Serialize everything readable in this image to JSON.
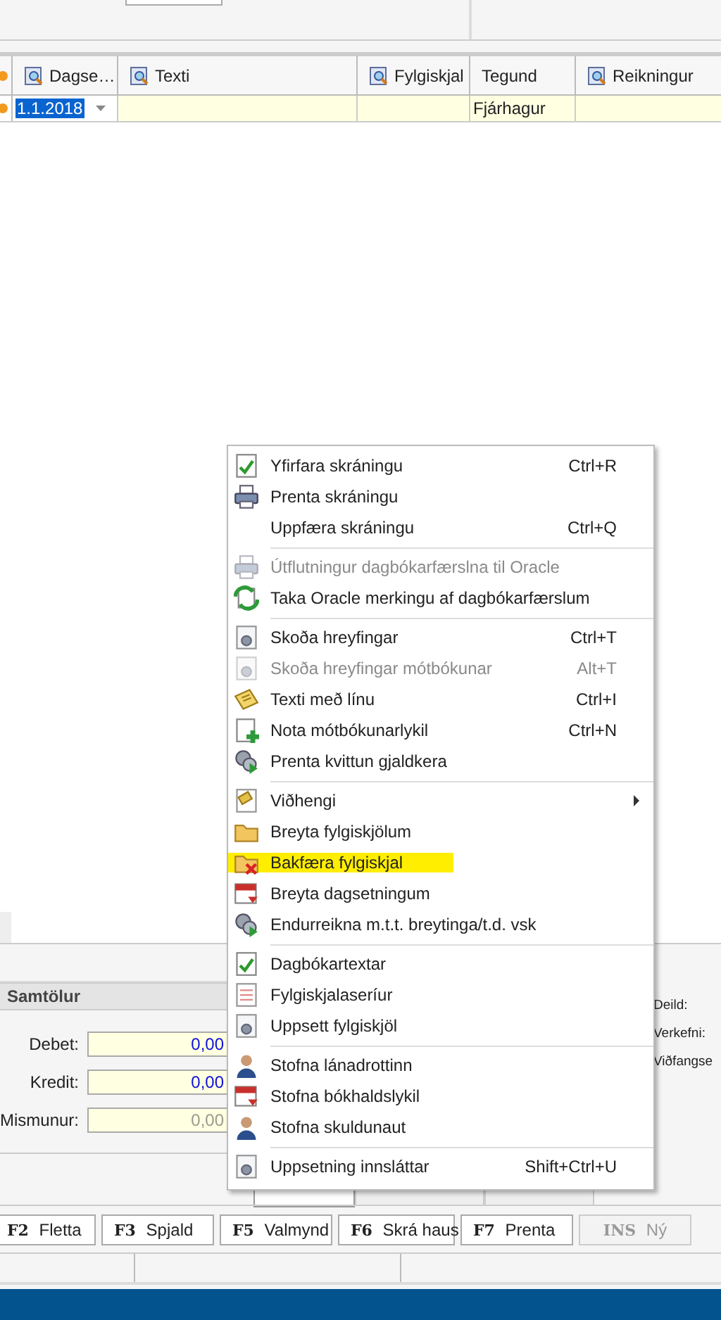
{
  "grid": {
    "columns": [
      {
        "label": "Dagse…"
      },
      {
        "label": "Texti"
      },
      {
        "label": "Fylgiskjal"
      },
      {
        "label": "Tegund"
      },
      {
        "label": "Reikningur"
      }
    ],
    "row": {
      "date": "1.1.2018",
      "cells": [
        "",
        "",
        "Fjárhagur",
        ""
      ]
    }
  },
  "summary": {
    "title": "Samtölur",
    "fields": [
      {
        "label": "Debet:",
        "value": "0,00",
        "disabled": false
      },
      {
        "label": "Kredit:",
        "value": "0,00",
        "disabled": false
      },
      {
        "label": "Mismunur:",
        "value": "0,00",
        "disabled": true
      }
    ]
  },
  "side_labels": [
    "Deild:",
    "Verkefni:",
    "Viðfangse"
  ],
  "tabs": [
    {
      "selected": true
    },
    {
      "selected": false
    },
    {
      "selected": false
    }
  ],
  "function_keys": [
    {
      "key": "F2",
      "label": "Fletta",
      "disabled": false
    },
    {
      "key": "F3",
      "label": "Spjald",
      "disabled": false
    },
    {
      "key": "F5",
      "label": "Valmynd",
      "disabled": false
    },
    {
      "key": "F6",
      "label": "Skrá haus",
      "disabled": false
    },
    {
      "key": "F7",
      "label": "Prenta",
      "disabled": false
    },
    {
      "key": "INS",
      "label": "Ný",
      "disabled": true
    }
  ],
  "context_menu": [
    {
      "kind": "item",
      "label": "Yfirfara skráningu",
      "shortcut": "Ctrl+R",
      "disabled": false,
      "highlighted": false,
      "submenu": false
    },
    {
      "kind": "item",
      "label": "Prenta skráningu",
      "disabled": false,
      "highlighted": false,
      "submenu": false
    },
    {
      "kind": "item",
      "label": "Uppfæra skráningu",
      "shortcut": "Ctrl+Q",
      "disabled": false,
      "highlighted": false,
      "submenu": false
    },
    {
      "kind": "separator"
    },
    {
      "kind": "item",
      "label": "Útflutningur dagbókarfærslna til Oracle",
      "disabled": true,
      "highlighted": false,
      "submenu": false
    },
    {
      "kind": "item",
      "label": "Taka Oracle merkingu af dagbókarfærslum",
      "disabled": false,
      "highlighted": false,
      "submenu": false
    },
    {
      "kind": "separator"
    },
    {
      "kind": "item",
      "label": "Skoða hreyfingar",
      "shortcut": "Ctrl+T",
      "disabled": false,
      "highlighted": false,
      "submenu": false
    },
    {
      "kind": "item",
      "label": "Skoða hreyfingar mótbókunar",
      "shortcut": "Alt+T",
      "disabled": true,
      "highlighted": false,
      "submenu": false
    },
    {
      "kind": "item",
      "label": "Texti með línu",
      "shortcut": "Ctrl+I",
      "disabled": false,
      "highlighted": false,
      "submenu": false
    },
    {
      "kind": "item",
      "label": "Nota mótbókunarlykil",
      "shortcut": "Ctrl+N",
      "disabled": false,
      "highlighted": false,
      "submenu": false
    },
    {
      "kind": "item",
      "label": "Prenta kvittun gjaldkera",
      "disabled": false,
      "highlighted": false,
      "submenu": false
    },
    {
      "kind": "separator"
    },
    {
      "kind": "item",
      "label": "Viðhengi",
      "disabled": false,
      "highlighted": false,
      "submenu": true
    },
    {
      "kind": "item",
      "label": "Breyta fylgiskjölum",
      "disabled": false,
      "highlighted": false,
      "submenu": false
    },
    {
      "kind": "item",
      "label": "Bakfæra fylgiskjal",
      "disabled": false,
      "highlighted": true,
      "submenu": false
    },
    {
      "kind": "item",
      "label": "Breyta dagsetningum",
      "disabled": false,
      "highlighted": false,
      "submenu": false
    },
    {
      "kind": "item",
      "label": "Endurreikna m.t.t. breytinga/t.d. vsk",
      "disabled": false,
      "highlighted": false,
      "submenu": false
    },
    {
      "kind": "separator"
    },
    {
      "kind": "item",
      "label": "Dagbókartextar",
      "disabled": false,
      "highlighted": false,
      "submenu": false
    },
    {
      "kind": "item",
      "label": "Fylgiskjalaseríur",
      "disabled": false,
      "highlighted": false,
      "submenu": false
    },
    {
      "kind": "item",
      "label": "Uppsett fylgiskjöl",
      "disabled": false,
      "highlighted": false,
      "submenu": false
    },
    {
      "kind": "separator"
    },
    {
      "kind": "item",
      "label": "Stofna lánadrottinn",
      "disabled": false,
      "highlighted": false,
      "submenu": false
    },
    {
      "kind": "item",
      "label": "Stofna bókhaldslykil",
      "disabled": false,
      "highlighted": false,
      "submenu": false
    },
    {
      "kind": "item",
      "label": "Stofna skuldunaut",
      "disabled": false,
      "highlighted": false,
      "submenu": false
    },
    {
      "kind": "separator"
    },
    {
      "kind": "item",
      "label": "Uppsetning innsláttar",
      "shortcut": "Shift+Ctrl+U",
      "disabled": false,
      "highlighted": false,
      "submenu": false
    }
  ]
}
